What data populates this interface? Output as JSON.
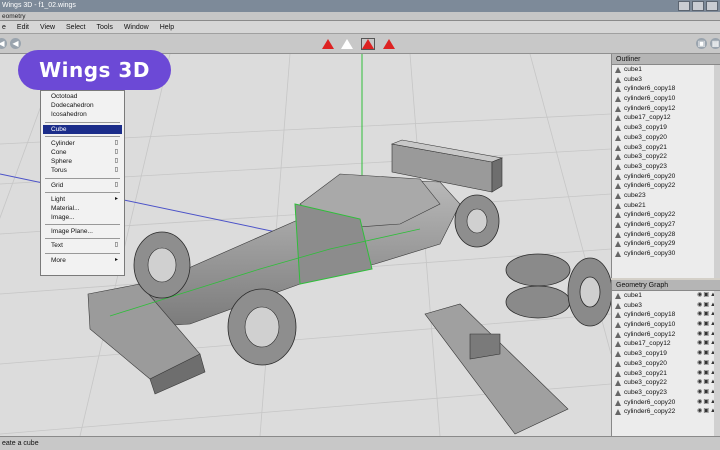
{
  "window": {
    "title": "Wings 3D - f1_02.wings"
  },
  "tab": {
    "label": "eometry"
  },
  "menu": [
    "e",
    "Edit",
    "View",
    "Select",
    "Tools",
    "Window",
    "Help"
  ],
  "logo": {
    "text": "Wings 3D",
    "color": "#6c49d6"
  },
  "context_menu": {
    "items": [
      {
        "label": "Octotoad"
      },
      {
        "label": "Dodecahedron"
      },
      {
        "label": "Icosahedron"
      },
      {
        "sep": true
      },
      {
        "label": "Cube",
        "selected": true
      },
      {
        "sep": true
      },
      {
        "label": "Cylinder",
        "mark": "▯"
      },
      {
        "label": "Cone",
        "mark": "▯"
      },
      {
        "label": "Sphere",
        "mark": "▯"
      },
      {
        "label": "Torus",
        "mark": "▯"
      },
      {
        "sep": true
      },
      {
        "label": "Grid",
        "mark": "▯"
      },
      {
        "sep": true
      },
      {
        "label": "Light",
        "mark": "▸"
      },
      {
        "label": "Material..."
      },
      {
        "label": "Image..."
      },
      {
        "sep": true
      },
      {
        "label": "Image Plane..."
      },
      {
        "sep": true
      },
      {
        "label": "Text",
        "mark": "▯"
      },
      {
        "sep": true
      },
      {
        "label": "More",
        "mark": "▸"
      }
    ]
  },
  "outliner": {
    "title": "Outliner",
    "items": [
      "cube1",
      "cube3",
      "cylinder6_copy18",
      "cylinder6_copy10",
      "cylinder6_copy12",
      "cube17_copy12",
      "cube3_copy19",
      "cube3_copy20",
      "cube3_copy21",
      "cube3_copy22",
      "cube3_copy23",
      "cylinder6_copy20",
      "cylinder6_copy22",
      "cube23",
      "cube21",
      "cylinder6_copy22",
      "cylinder6_copy27",
      "cylinder6_copy28",
      "cylinder6_copy29",
      "cylinder6_copy30"
    ]
  },
  "geometry_graph": {
    "title": "Geometry Graph",
    "items": [
      "cube1",
      "cube3",
      "cylinder6_copy18",
      "cylinder6_copy10",
      "cylinder6_copy12",
      "cube17_copy12",
      "cube3_copy19",
      "cube3_copy20",
      "cube3_copy21",
      "cube3_copy22",
      "cube3_copy23",
      "cylinder6_copy20",
      "cylinder6_copy22"
    ]
  },
  "status": {
    "text": "eate a cube"
  }
}
